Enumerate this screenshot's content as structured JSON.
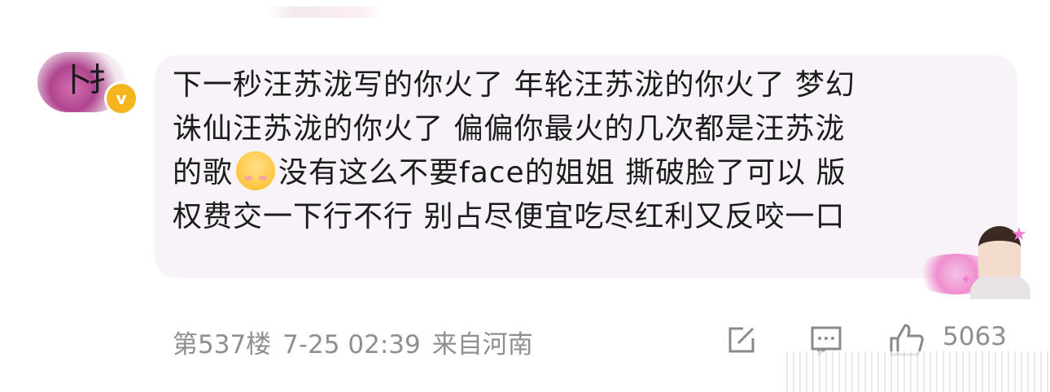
{
  "comment": {
    "lines": [
      "下一秒汪苏泷写的你火了 年轮汪苏泷的你火了 梦幻",
      "诛仙汪苏泷的你火了 偏偏你最火的几次都是汪苏泷",
      "的歌",
      "没有这么不要face的姐姐 撕破脸了可以 版",
      "权费交一下行不行 别占尽便宜吃尽红利又反咬一口"
    ]
  },
  "user": {
    "verified_badge": "v"
  },
  "meta": {
    "floor": "第537楼",
    "time": "7-25 02:39",
    "location": "来自河南"
  },
  "actions": {
    "like_count": "5063"
  },
  "colors": {
    "bubble_bg": "#f7f3f9",
    "text": "#1c1c1c",
    "meta_text": "#8f8f8f",
    "badge": "#f5b51d"
  },
  "icons": {
    "share": "share-edit-icon",
    "comment": "comment-icon",
    "like": "thumbs-up-icon",
    "emoji": "smile-emoji-icon"
  }
}
